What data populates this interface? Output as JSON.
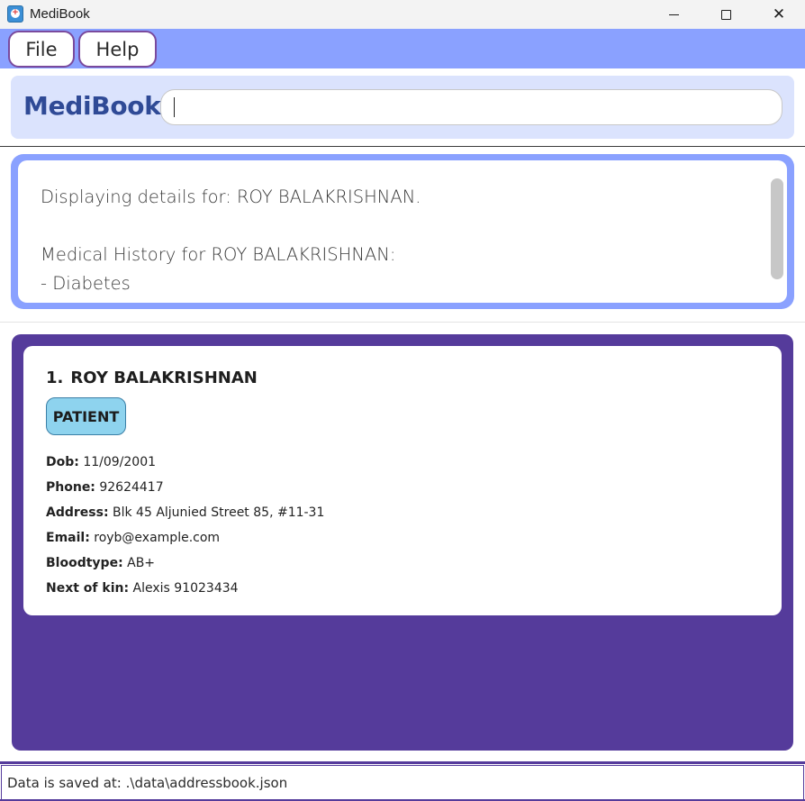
{
  "window": {
    "title": "MediBook",
    "icon": "medibook-app-icon",
    "controls": {
      "minimize": "minimize-icon",
      "maximize": "maximize-icon",
      "close": "close-icon",
      "close_glyph": "✕"
    }
  },
  "menu": {
    "file_label": "File",
    "help_label": "Help"
  },
  "header": {
    "brand": "MediBook",
    "command_value": "",
    "command_placeholder": ""
  },
  "result": {
    "lines": [
      "Displaying details for: ROY BALAKRISHNAN.",
      "",
      "Medical History for ROY BALAKRISHNAN:",
      "- Diabetes"
    ]
  },
  "persons": [
    {
      "index": "1.",
      "name": "ROY BALAKRISHNAN",
      "tag": "PATIENT",
      "fields": [
        {
          "label": "Dob:",
          "value": "11/09/2001"
        },
        {
          "label": "Phone:",
          "value": "92624417"
        },
        {
          "label": "Address:",
          "value": "Blk 45 Aljunied Street 85, #11-31"
        },
        {
          "label": "Email:",
          "value": "royb@example.com"
        },
        {
          "label": "Bloodtype:",
          "value": "AB+"
        },
        {
          "label": "Next of kin:",
          "value": "Alexis 91023434"
        }
      ]
    }
  ],
  "status": {
    "text": "Data is saved at: .\\data\\addressbook.json"
  },
  "colors": {
    "menubar": "#8aa1ff",
    "header_panel": "#dbe3fd",
    "brand": "#2f4a96",
    "list_panel": "#553b9b",
    "tag": "#8ed3ee"
  }
}
